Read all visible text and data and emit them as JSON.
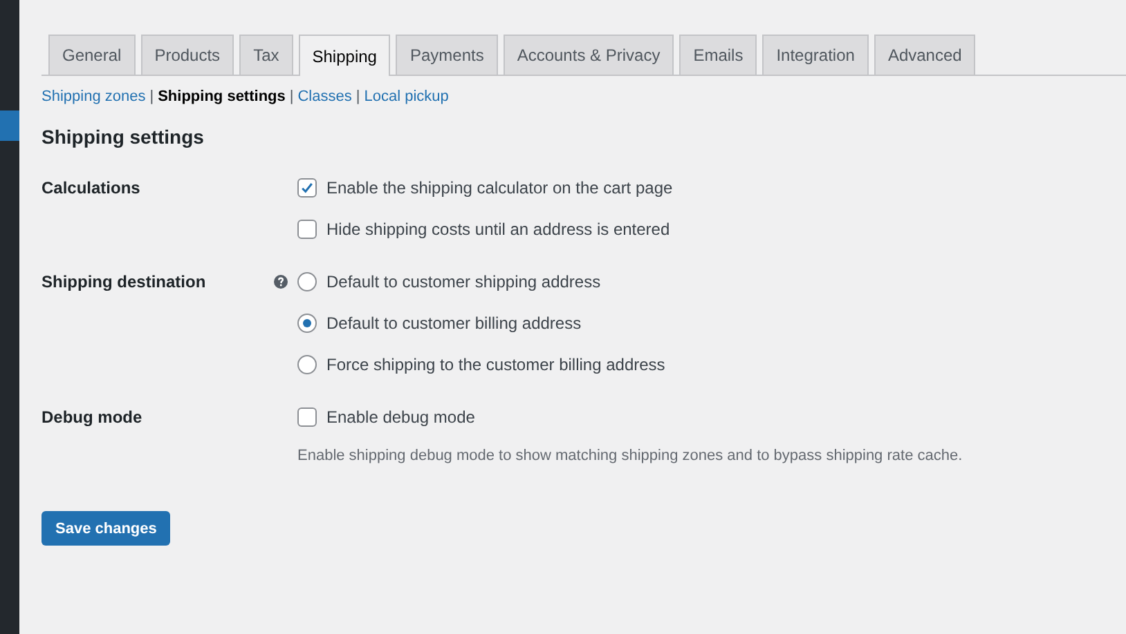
{
  "tabs": [
    {
      "label": "General",
      "selected": false
    },
    {
      "label": "Products",
      "selected": false
    },
    {
      "label": "Tax",
      "selected": false
    },
    {
      "label": "Shipping",
      "selected": true
    },
    {
      "label": "Payments",
      "selected": false
    },
    {
      "label": "Accounts & Privacy",
      "selected": false
    },
    {
      "label": "Emails",
      "selected": false
    },
    {
      "label": "Integration",
      "selected": false
    },
    {
      "label": "Advanced",
      "selected": false
    }
  ],
  "subnav": [
    {
      "label": "Shipping zones",
      "selected": false
    },
    {
      "separator": "|",
      "label": "Shipping settings",
      "selected": true
    },
    {
      "separator": "|",
      "label": "Classes",
      "selected": false
    },
    {
      "separator": "|",
      "label": "Local pickup",
      "selected": false
    }
  ],
  "heading": "Shipping settings",
  "sections": [
    {
      "label": "Calculations",
      "help": false,
      "options": [
        {
          "kind": "checkbox",
          "label": "Enable the shipping calculator on the cart page",
          "checked": true
        },
        {
          "kind": "checkbox",
          "label": "Hide shipping costs until an address is entered",
          "checked": false
        }
      ]
    },
    {
      "label": "Shipping destination",
      "help": true,
      "options": [
        {
          "kind": "radio",
          "label": "Default to customer shipping address",
          "selected": false
        },
        {
          "kind": "radio",
          "label": "Default to customer billing address",
          "selected": true
        },
        {
          "kind": "radio",
          "label": "Force shipping to the customer billing address",
          "selected": false
        }
      ]
    },
    {
      "label": "Debug mode",
      "help": false,
      "options": [
        {
          "kind": "checkbox",
          "label": "Enable debug mode",
          "checked": false
        }
      ],
      "description": "Enable shipping debug mode to show matching shipping zones and to bypass shipping rate cache."
    }
  ],
  "save_button": "Save changes"
}
